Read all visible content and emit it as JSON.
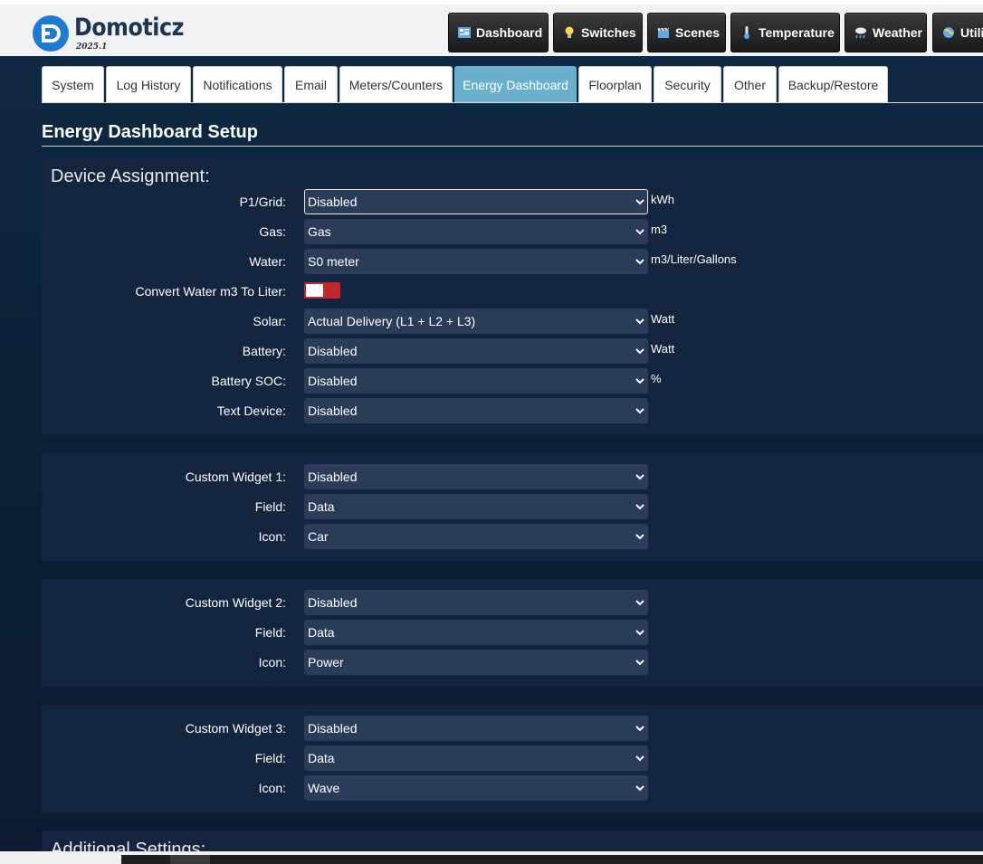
{
  "brand": {
    "name": "Domoticz",
    "version": "2025.1",
    "logo_color": "#1d7bd2"
  },
  "main_nav": [
    {
      "label": "Dashboard",
      "icon": "dashboard-icon"
    },
    {
      "label": "Switches",
      "icon": "lightbulb-icon"
    },
    {
      "label": "Scenes",
      "icon": "clapperboard-icon"
    },
    {
      "label": "Temperature",
      "icon": "thermometer-icon"
    },
    {
      "label": "Weather",
      "icon": "cloud-rain-icon"
    },
    {
      "label": "Utili",
      "icon": "globe-icon"
    }
  ],
  "tabs": [
    {
      "label": "System"
    },
    {
      "label": "Log History"
    },
    {
      "label": "Notifications"
    },
    {
      "label": "Email"
    },
    {
      "label": "Meters/Counters"
    },
    {
      "label": "Energy Dashboard",
      "active": true
    },
    {
      "label": "Floorplan"
    },
    {
      "label": "Security"
    },
    {
      "label": "Other"
    },
    {
      "label": "Backup/Restore"
    }
  ],
  "page": {
    "title": "Energy Dashboard Setup"
  },
  "device_assignment": {
    "title": "Device Assignment:",
    "p1_grid": {
      "label": "P1/Grid:",
      "value": "Disabled",
      "unit": "kWh"
    },
    "gas": {
      "label": "Gas:",
      "value": "Gas",
      "unit": "m3"
    },
    "water": {
      "label": "Water:",
      "value": "S0 meter",
      "unit": "m3/Liter/Gallons"
    },
    "convert_water": {
      "label": "Convert Water m3 To Liter:",
      "on": false,
      "color": "#c1272d"
    },
    "solar": {
      "label": "Solar:",
      "value": "Actual Delivery (L1 + L2 + L3)",
      "unit": "Watt"
    },
    "battery": {
      "label": "Battery:",
      "value": "Disabled",
      "unit": "Watt"
    },
    "battery_soc": {
      "label": "Battery SOC:",
      "value": "Disabled",
      "unit": "%"
    },
    "text_device": {
      "label": "Text Device:",
      "value": "Disabled"
    }
  },
  "custom_widgets": [
    {
      "widget": {
        "label": "Custom Widget 1:",
        "value": "Disabled"
      },
      "field": {
        "label": "Field:",
        "value": "Data"
      },
      "icon": {
        "label": "Icon:",
        "value": "Car"
      }
    },
    {
      "widget": {
        "label": "Custom Widget 2:",
        "value": "Disabled"
      },
      "field": {
        "label": "Field:",
        "value": "Data"
      },
      "icon": {
        "label": "Icon:",
        "value": "Power"
      }
    },
    {
      "widget": {
        "label": "Custom Widget 3:",
        "value": "Disabled"
      },
      "field": {
        "label": "Field:",
        "value": "Data"
      },
      "icon": {
        "label": "Icon:",
        "value": "Wave"
      }
    }
  ],
  "additional_settings": {
    "title": "Additional Settings:"
  },
  "colors": {
    "active_tab": "#6ab0cd",
    "select_bg": "#2b3c59",
    "panel_bg": "#14263f"
  }
}
